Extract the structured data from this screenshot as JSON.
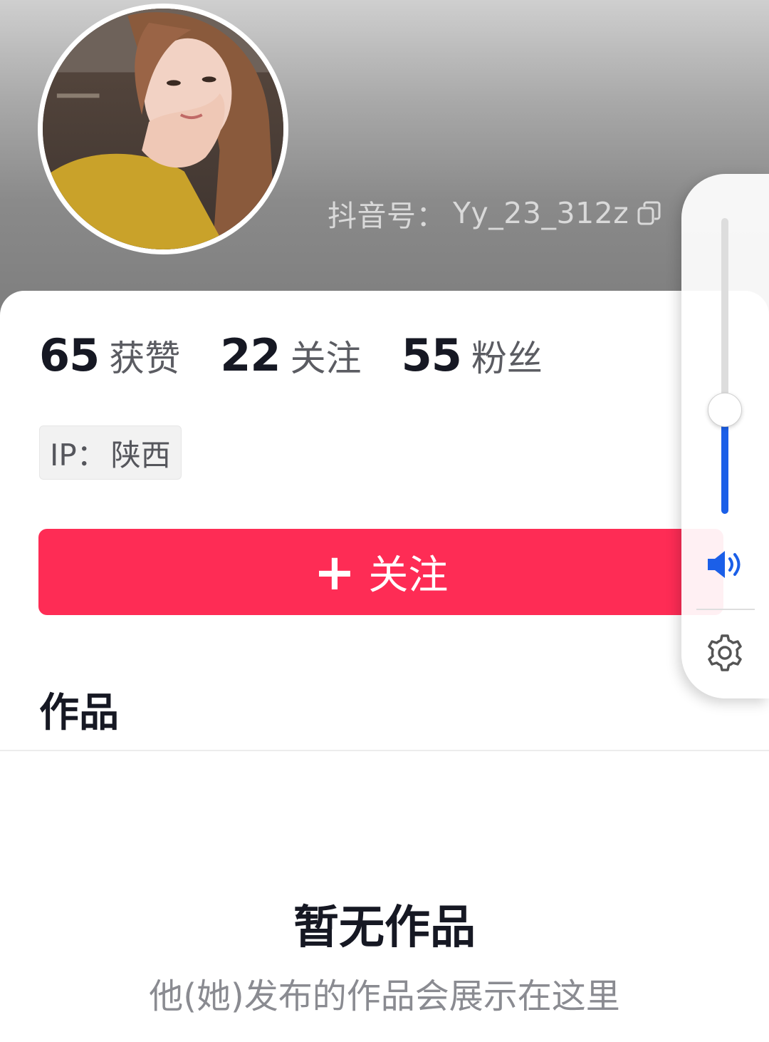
{
  "profile": {
    "douyin_id_label": "抖音号：",
    "douyin_id_value": "Yy_23_312z",
    "copy_icon": "copy-icon",
    "avatar": "profile photo"
  },
  "stats": [
    {
      "value": "65",
      "label": "获赞"
    },
    {
      "value": "22",
      "label": "关注"
    },
    {
      "value": "55",
      "label": "粉丝"
    }
  ],
  "ip": {
    "label": "IP：",
    "location": "陕西"
  },
  "follow_button": {
    "plus": "+",
    "label": "关注",
    "color": "#fe2c55"
  },
  "tabs": {
    "works": "作品"
  },
  "empty_state": {
    "title": "暂无作品",
    "subtitle": "他(她)发布的作品会展示在这里"
  },
  "volume_panel": {
    "level": 0.35,
    "accent": "#1b5fe8",
    "icons": [
      "speaker-icon",
      "gear-icon"
    ]
  }
}
